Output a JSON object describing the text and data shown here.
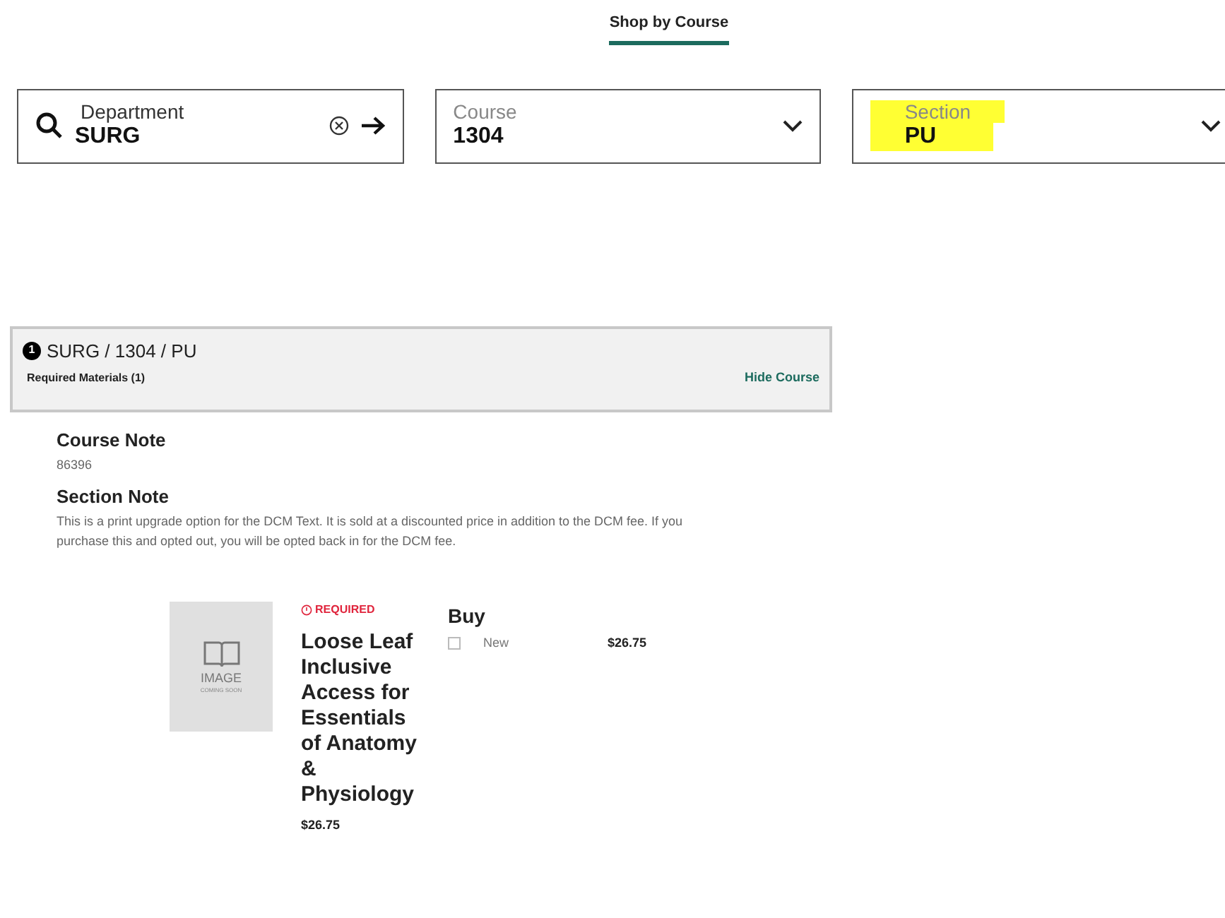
{
  "tab": {
    "label": "Shop by Course",
    "selected": true
  },
  "fields": [
    {
      "kind": "search",
      "label": "Department",
      "value": "SURG",
      "highlighted": false
    },
    {
      "kind": "select",
      "label": "Course",
      "value": "1304",
      "highlighted": false
    },
    {
      "kind": "select",
      "label": "Section",
      "value": "PU",
      "highlighted": true
    }
  ],
  "course": {
    "number": "1",
    "title": "SURG / 1304 / PU",
    "subtitle": "Required Materials (1)",
    "toggle": "Hide Course"
  },
  "notes": [
    {
      "heading": "Course Note",
      "body": "86396"
    },
    {
      "heading": "Section Note",
      "body": "This is a print upgrade option for the DCM Text. It is sold at a discounted price in addition to the DCM fee. If you purchase this and opted out, you will be opted back in for the DCM fee."
    }
  ],
  "product": {
    "image_text": "IMAGE",
    "image_subtext": "COMING SOON",
    "badge": "REQUIRED",
    "title": "Loose Leaf Inclusive Access for Essentials of Anatomy & Physiology",
    "price": "$26.75",
    "buy_heading": "Buy",
    "options": [
      {
        "label": "New",
        "price": "$26.75",
        "checked": false
      }
    ]
  }
}
